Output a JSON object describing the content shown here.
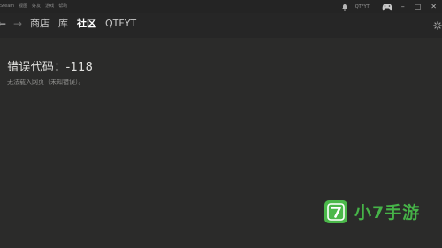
{
  "topbar": {
    "menu": [
      "Steam",
      "视图",
      "好友",
      "游戏",
      "帮助"
    ],
    "username": "QTFYT",
    "notification_icon": "bell-icon",
    "controller_icon": "controller-icon",
    "window_controls": [
      "–",
      "□",
      "✕"
    ]
  },
  "nav": {
    "back": "←",
    "forward": "→",
    "links": [
      {
        "label": "商店",
        "active": false
      },
      {
        "label": "库",
        "active": false
      },
      {
        "label": "社区",
        "active": true
      },
      {
        "label": "QTFYT",
        "active": false
      }
    ],
    "settings_icon": "loading-icon"
  },
  "error": {
    "title": "错误代码：-118",
    "message": "无法载入网页（未知错误）。"
  },
  "watermark": {
    "logo_glyph": "7",
    "text": "小7手游",
    "color": "#46b348"
  }
}
